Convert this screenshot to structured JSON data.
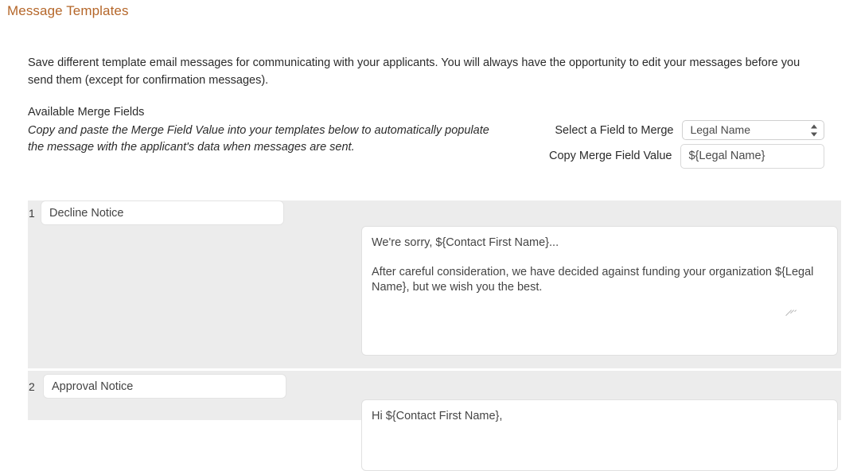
{
  "page": {
    "title": "Message Templates",
    "title_color": "#b5672a",
    "intro": "Save different template email messages for communicating with your applicants. You will always have the opportunity to edit your messages before you send them (except for confirmation messages)."
  },
  "merge_fields": {
    "heading": "Available Merge Fields",
    "description": "Copy and paste the Merge Field Value into your templates below to automatically populate the message with the applicant's data when messages are sent.",
    "select_label": "Select a Field to Merge",
    "select_value": "Legal Name",
    "select_options": [
      "Legal Name"
    ],
    "copy_label": "Copy Merge Field Value",
    "copy_value": "${Legal Name}"
  },
  "templates": [
    {
      "index": "1",
      "title": "Decline Notice",
      "body": "We're sorry, ${Contact First Name}...\n\nAfter careful consideration, we have decided against funding your organization ${Legal Name}, but we wish you the best."
    },
    {
      "index": "2",
      "title": "Approval Notice",
      "body": "Hi ${Contact First Name},"
    }
  ]
}
